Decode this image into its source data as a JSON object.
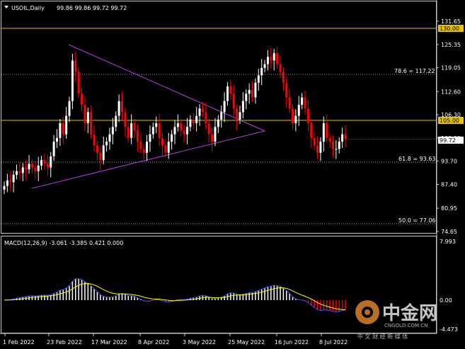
{
  "header": {
    "symbol": "USOIL,Daily",
    "ohlc": "99.86 99.86 99.72 99.72"
  },
  "price_axis": {
    "ticks": [
      "131.65",
      "125.35",
      "119.05",
      "112.60",
      "106.30",
      "100.00",
      "93.70",
      "87.40",
      "80.95",
      "74.65"
    ],
    "tags": {
      "level_130": "130.00",
      "level_105": "105.00",
      "current": "99.72"
    }
  },
  "fib_labels": {
    "f786": "78.6 = 117.22",
    "f618": "61.8 = 93.63",
    "f500": "50.0 = 77.06"
  },
  "macd": {
    "label": "MACD(12,26,9) -3.061 -3.385 0.421 0.000",
    "ticks": [
      "7.993",
      "0.00",
      "-4.473"
    ]
  },
  "dates": [
    "1 Feb 2022",
    "23 Feb 2022",
    "17 Mar 2022",
    "8 Apr 2022",
    "3 May 2022",
    "25 May 2022",
    "16 Jun 2022",
    "8 Jul 2022"
  ],
  "watermark": {
    "brand": "中金网",
    "url": "CNGOLD.COM.CN",
    "tagline": "中 文 财 经 新 媒 体"
  },
  "colors": {
    "bull": "#ffffff",
    "bear": "#ff0000",
    "hline": "#e6c200",
    "triangle": "#b43cdc",
    "macd_signal": "#ffff00",
    "macd_line": "#3355ff"
  },
  "chart_data": {
    "type": "candlestick",
    "symbol": "USOIL",
    "timeframe": "Daily",
    "ylim": [
      74.65,
      131.65
    ],
    "horizontal_levels": [
      130.0,
      105.0
    ],
    "fib_levels": [
      {
        "ratio": 78.6,
        "price": 117.22
      },
      {
        "ratio": 61.8,
        "price": 93.63
      },
      {
        "ratio": 50.0,
        "price": 77.06
      }
    ],
    "close_approx": [
      87,
      88.5,
      88,
      90,
      91,
      90.5,
      92,
      91.5,
      93,
      92,
      91,
      92.5,
      94,
      93,
      92,
      95,
      99,
      100,
      104,
      101,
      106,
      110,
      121,
      118,
      112,
      109,
      104,
      107,
      101,
      98,
      96,
      94,
      98,
      99,
      101,
      103,
      106,
      110,
      107,
      103,
      100,
      104,
      102,
      99,
      97,
      96,
      99,
      101,
      103,
      104,
      100,
      98,
      96,
      99,
      101,
      103,
      104,
      102,
      101,
      103,
      105,
      104,
      106,
      108,
      107,
      104,
      101,
      99,
      103,
      105,
      107,
      110,
      114,
      112,
      108,
      105,
      107,
      110,
      112,
      113,
      111,
      115,
      117,
      119,
      120,
      122,
      121,
      123,
      120,
      118,
      115,
      111,
      108,
      104,
      106,
      109,
      111,
      108,
      104,
      100,
      98,
      96,
      99,
      104,
      100,
      99,
      97,
      97,
      99,
      101,
      99.72
    ],
    "macd_last": {
      "macd": -3.061,
      "signal": -3.385,
      "histogram": 0.421
    }
  }
}
